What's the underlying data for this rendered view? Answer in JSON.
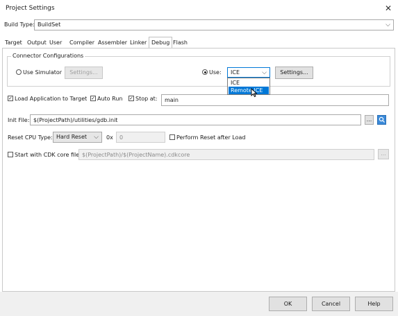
{
  "window": {
    "title": "Project Settings",
    "close_glyph": "✕"
  },
  "build_type": {
    "label": "Build Type:",
    "value": "BuildSet"
  },
  "tabs": [
    {
      "label": "Target"
    },
    {
      "label": "Output"
    },
    {
      "label": "User"
    },
    {
      "label": "Compiler"
    },
    {
      "label": "Assembler"
    },
    {
      "label": "Linker"
    },
    {
      "label": "Debug"
    },
    {
      "label": "Flash"
    }
  ],
  "connector": {
    "title": "Connector Configurations",
    "use_simulator_label": "Use Simulator",
    "simulator_settings_label": "Settings...",
    "use_label": "Use:",
    "use_value": "ICE",
    "use_settings_label": "Settings...",
    "dropdown_options": [
      "ICE",
      "Remote ICE"
    ]
  },
  "options": {
    "load_app_label": "Load Application to Target",
    "auto_run_label": "Auto Run",
    "stop_at_label": "Stop at:",
    "stop_at_value": "main",
    "check_glyph": "✓"
  },
  "init_file": {
    "label": "Init File:",
    "value": "$(ProjectPath)/utilities/gdb.init",
    "browse_label": "..."
  },
  "reset": {
    "label": "Reset CPU Type:",
    "value": "Hard Reset",
    "hex_prefix": "0x",
    "address_value": "0",
    "perform_reset_label": "Perform Reset after Load"
  },
  "cdk_core": {
    "label": "Start with CDK core file:",
    "value": "$(ProjectPath)/$(ProjectName).cdkcore",
    "browse_label": "..."
  },
  "footer": {
    "ok_label": "OK",
    "cancel_label": "Cancel",
    "help_label": "Help"
  },
  "colors": {
    "selection_blue": "#0078d7"
  }
}
